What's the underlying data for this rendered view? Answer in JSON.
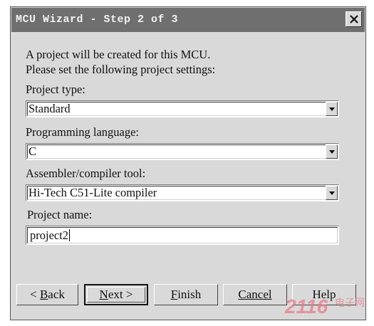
{
  "window": {
    "title": "MCU Wizard - Step 2 of 3"
  },
  "intro": {
    "line1": "A project will be created for this MCU.",
    "line2": "Please set the following project settings:"
  },
  "project_type": {
    "label": "Project type:",
    "value": "Standard"
  },
  "programming_language": {
    "label": "Programming language:",
    "value": "C"
  },
  "assembler_tool": {
    "label": "Assembler/compiler tool:",
    "value": "Hi-Tech C51-Lite compiler"
  },
  "project_name": {
    "label": "Project name:",
    "value": "project2"
  },
  "buttons": {
    "back": {
      "prefix": "< ",
      "mnemonic": "B",
      "rest": "ack"
    },
    "next": {
      "mnemonic": "N",
      "rest": "ext >"
    },
    "finish": {
      "mnemonic": "F",
      "rest": "inish"
    },
    "cancel": {
      "label": "Cancel"
    },
    "help": {
      "label": "Help"
    }
  },
  "watermark": {
    "text": "2116",
    "sub": "电子网"
  },
  "colors": {
    "titlebar": "#6f6f6f",
    "dialog": "#d9d9d9",
    "watermark": "#e87a8a"
  }
}
